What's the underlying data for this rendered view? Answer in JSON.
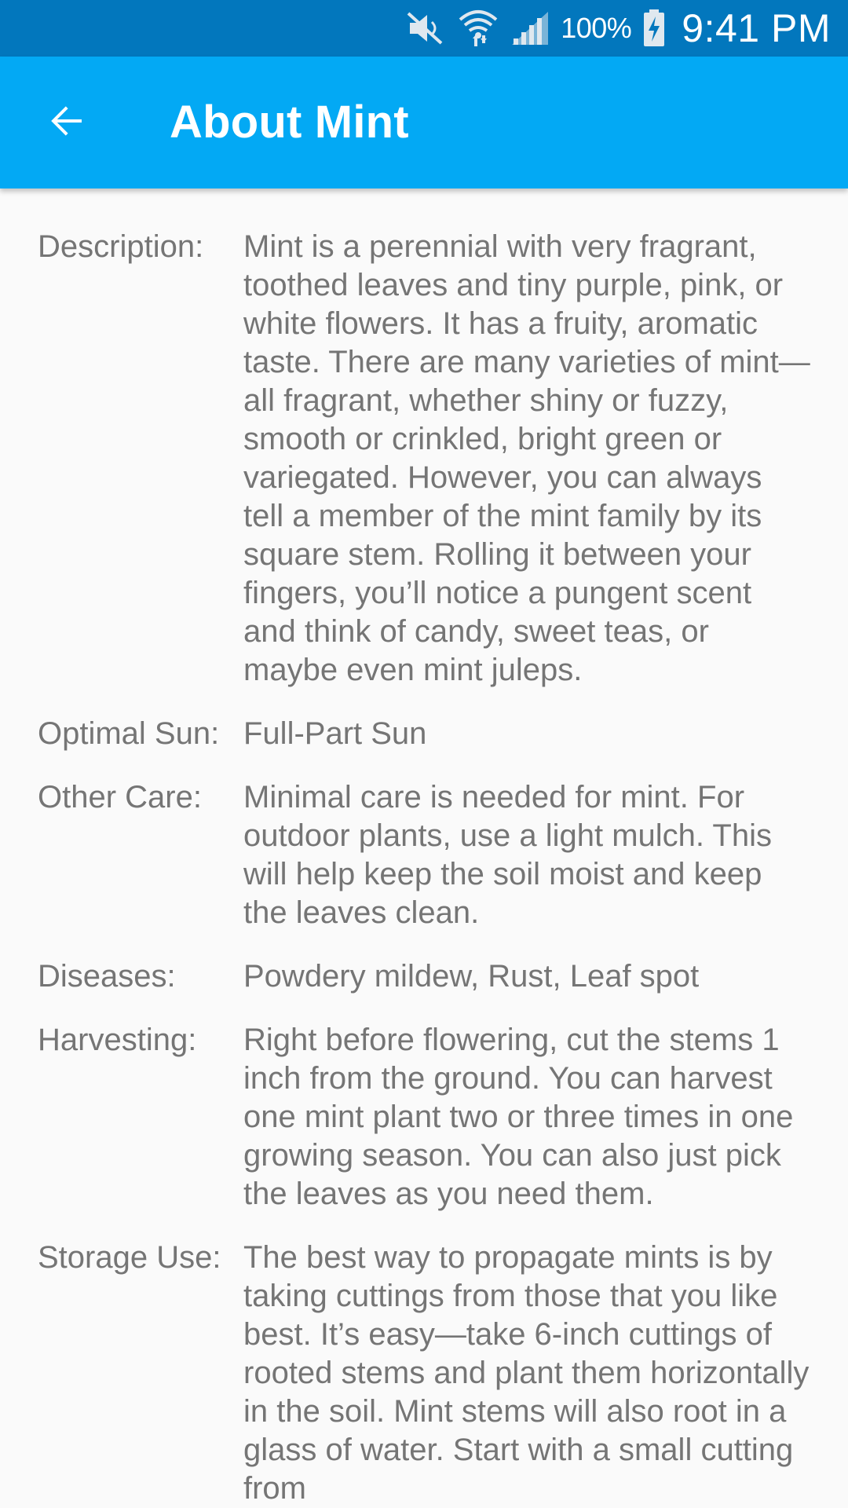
{
  "status_bar": {
    "battery_percent": "100%",
    "time": "9:41 PM",
    "icons": [
      "mute-icon",
      "wifi-icon",
      "signal-icon",
      "battery-charging-icon"
    ]
  },
  "app_bar": {
    "title": "About Mint",
    "back_icon": "arrow-back-icon",
    "color": "#03a9f4",
    "status_color": "#0277bd"
  },
  "details": [
    {
      "label": "Description:",
      "value": "Mint is a perennial with very fragrant, toothed leaves and tiny purple, pink, or white flowers. It has a fruity, aromatic taste. There are many varieties of mint—all fragrant, whether shiny or fuzzy, smooth or crinkled, bright green or variegated. However, you can always tell a member of the mint family by its square stem. Rolling it between your fingers, you’ll notice a pungent scent and think of candy, sweet teas, or maybe even mint juleps."
    },
    {
      "label": "Optimal Sun:",
      "value": "Full-Part Sun"
    },
    {
      "label": "Other Care:",
      "value": "Minimal care is needed for mint. For outdoor plants, use a light mulch. This will help keep the soil moist and keep the leaves clean."
    },
    {
      "label": "Diseases:",
      "value": "Powdery mildew, Rust, Leaf spot"
    },
    {
      "label": "Harvesting:",
      "value": "Right before flowering, cut the stems 1 inch from the ground. You can harvest one mint plant two or three times in one growing season. You can also just pick the leaves as you need them."
    },
    {
      "label": "Storage Use:",
      "value": "The best way to propagate mints is by taking cuttings from those that you like best. It’s easy—take 6-inch cuttings of rooted stems and plant them horizontally in the soil. Mint stems will also root in a glass of water. Start with a small cutting from"
    }
  ]
}
